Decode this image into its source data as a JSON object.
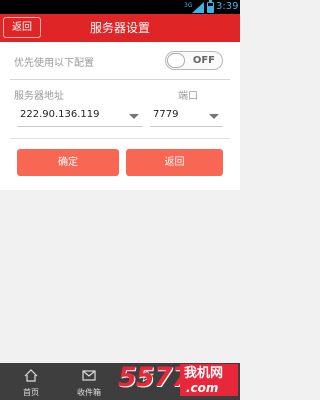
{
  "status_bar": {
    "network": "3G",
    "time": "3:39"
  },
  "header": {
    "back_label": "返回",
    "title": "服务器设置"
  },
  "preference": {
    "label": "优先使用以下配置",
    "toggle_text": "OFF"
  },
  "server": {
    "address_label": "服务器地址",
    "port_label": "端口",
    "address_value": "222.90.136.119",
    "port_value": "7779"
  },
  "actions": {
    "confirm_label": "确定",
    "return_label": "返回"
  },
  "bottom_nav": [
    {
      "label": "首页",
      "icon": "home-icon"
    },
    {
      "label": "收件箱",
      "icon": "mail-icon"
    },
    {
      "label": "",
      "icon": "star-icon"
    }
  ],
  "watermark": {
    "number": "5577",
    "text": "我机网",
    "domain": ".com"
  },
  "colors": {
    "header": "#e02527",
    "button": "#f86753",
    "status_accent": "#3cb4e5",
    "watermark": "#e8283a"
  }
}
